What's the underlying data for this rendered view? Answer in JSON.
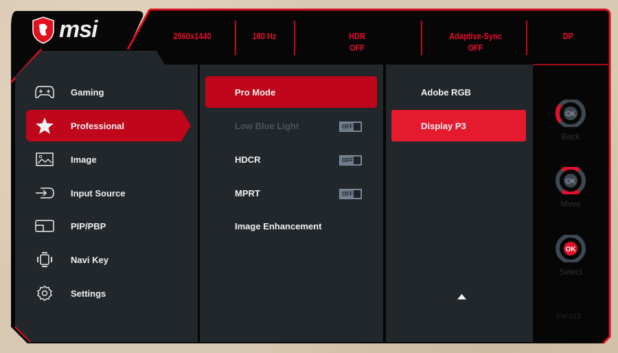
{
  "brand": {
    "logo_text": "msi",
    "accent": "#e8102c"
  },
  "header": {
    "resolution": "2560x1440",
    "refresh": "180 Hz",
    "hdr_label": "HDR",
    "hdr_value": "OFF",
    "sync_label": "Adaptive-Sync",
    "sync_value": "OFF",
    "input": "DP"
  },
  "sidebar": {
    "items": [
      {
        "label": "Gaming",
        "icon": "gamepad-icon"
      },
      {
        "label": "Professional",
        "icon": "star-icon",
        "active": true
      },
      {
        "label": "Image",
        "icon": "image-icon"
      },
      {
        "label": "Input Source",
        "icon": "input-icon"
      },
      {
        "label": "PIP/PBP",
        "icon": "pip-icon"
      },
      {
        "label": "Navi Key",
        "icon": "navi-key-icon"
      },
      {
        "label": "Settings",
        "icon": "gear-icon"
      }
    ]
  },
  "middle": {
    "items": [
      {
        "label": "Pro Mode"
      },
      {
        "label": "Low Blue Light",
        "toggle": "OFF"
      },
      {
        "label": "HDCR",
        "toggle": "OFF"
      },
      {
        "label": "MPRT",
        "toggle": "OFF"
      },
      {
        "label": "Image Enhancement"
      }
    ]
  },
  "right": {
    "items": [
      {
        "label": "Adobe RGB"
      },
      {
        "label": "Display P3"
      }
    ],
    "scroll_icon": "triangle-up-icon"
  },
  "nav": {
    "back": "Back",
    "move": "Move",
    "select": "Select",
    "ok": "OK",
    "firmware": "FW 013"
  }
}
